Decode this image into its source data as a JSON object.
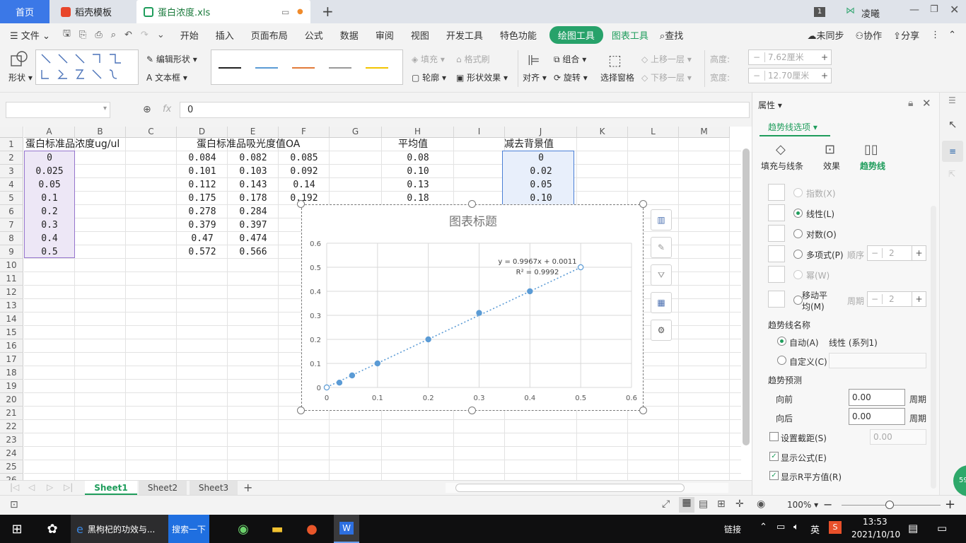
{
  "tabs": {
    "home": "首页",
    "template": "稻壳模板",
    "file": "蛋白浓度.xls",
    "user": "凌曦",
    "page_badge": "1"
  },
  "menu": {
    "file": "文件",
    "items": [
      "开始",
      "插入",
      "页面布局",
      "公式",
      "数据",
      "审阅",
      "视图",
      "开发工具",
      "特色功能"
    ],
    "draw_tools": "绘图工具",
    "chart_tools": "图表工具",
    "search": "查找",
    "sync": "未同步",
    "collab": "协作",
    "share": "分享"
  },
  "ribbon": {
    "shape": "形状",
    "edit_shape": "编辑形状",
    "textbox": "文本框",
    "fill": "填充",
    "format_brush": "格式刷",
    "outline": "轮廓",
    "shape_effect": "形状效果",
    "align": "对齐",
    "group": "组合",
    "rotate": "旋转",
    "select_pane": "选择窗格",
    "bring_forward": "上移一层",
    "send_backward": "下移一层",
    "height_label": "高度:",
    "height_value": "7.62厘米",
    "width_label": "宽度:",
    "width_value": "12.70厘米"
  },
  "formula": {
    "fx": "fx",
    "value": "0",
    "namebox": ""
  },
  "columns": [
    "A",
    "B",
    "C",
    "D",
    "E",
    "F",
    "G",
    "H",
    "I",
    "J",
    "K",
    "L",
    "M"
  ],
  "rows": [
    "1",
    "2",
    "3",
    "4",
    "5",
    "6",
    "7",
    "8",
    "9",
    "10",
    "11",
    "12",
    "13",
    "14",
    "15",
    "16",
    "17",
    "18",
    "19",
    "20",
    "21",
    "22",
    "23",
    "24",
    "25",
    "26"
  ],
  "cells": {
    "a1": "蛋白标准品浓度ug/ul",
    "d1": "蛋白标准品吸光度值OA",
    "h1": "平均值",
    "j1": "减去背景值",
    "colA": [
      "0",
      "0.025",
      "0.05",
      "0.1",
      "0.2",
      "0.3",
      "0.4",
      "0.5"
    ],
    "colD": [
      "0.084",
      "0.101",
      "0.112",
      "0.175",
      "0.278",
      "0.379",
      "0.47",
      "0.572"
    ],
    "colE": [
      "0.082",
      "0.103",
      "0.143",
      "0.178",
      "0.284",
      "0.397",
      "0.474",
      "0.566"
    ],
    "colF": [
      "0.085",
      "0.092",
      "0.14",
      "0.192"
    ],
    "colH": [
      "0.08",
      "0.10",
      "0.13",
      "0.18"
    ],
    "colJ": [
      "0",
      "0.02",
      "0.05",
      "0.10"
    ]
  },
  "chart_data": {
    "type": "scatter",
    "title": "图表标题",
    "x": [
      0,
      0.025,
      0.05,
      0.1,
      0.2,
      0.3,
      0.4,
      0.5
    ],
    "y": [
      0,
      0.02,
      0.05,
      0.1,
      0.2,
      0.31,
      0.4,
      0.5
    ],
    "xlim": [
      0,
      0.6
    ],
    "ylim": [
      0,
      0.6
    ],
    "xticks": [
      "0",
      "0.1",
      "0.2",
      "0.3",
      "0.4",
      "0.5",
      "0.6"
    ],
    "yticks": [
      "0",
      "0.1",
      "0.2",
      "0.3",
      "0.4",
      "0.5",
      "0.6"
    ],
    "trendline": {
      "type": "linear",
      "slope": 0.9967,
      "intercept": 0.0011,
      "equation": "y = 0.9967x + 0.0011",
      "r2": "R² = 0.9992"
    },
    "grid": true,
    "color": "#5b9bd5"
  },
  "sheets": [
    "Sheet1",
    "Sheet2",
    "Sheet3"
  ],
  "status": {
    "zoom": "100%"
  },
  "pane": {
    "title": "属性",
    "tab": "趋势线选项",
    "subtabs": [
      "填充与线条",
      "效果",
      "趋势线"
    ],
    "types": [
      "指数(X)",
      "线性(L)",
      "对数(O)",
      "多项式(P)",
      "幂(W)",
      "移动平均(M)"
    ],
    "order_label": "顺序",
    "order_value": "2",
    "period_label": "周期",
    "period_value": "2",
    "name_section": "趋势线名称",
    "auto": "自动(A)",
    "auto_value": "线性 (系列1)",
    "custom": "自定义(C)",
    "forecast_section": "趋势预测",
    "forward": "向前",
    "backward": "向后",
    "forward_value": "0.00",
    "backward_value": "0.00",
    "unit": "周期",
    "intercept": "设置截距(S)",
    "intercept_value": "0.00",
    "show_eq": "显示公式(E)",
    "show_r2": "显示R平方值(R)"
  },
  "taskbar": {
    "browser_task": "黑枸杞的功效与...",
    "search_btn": "搜索一下",
    "link": "链接",
    "ime": "英",
    "time": "13:53",
    "date": "2021/10/10",
    "badge": "59"
  }
}
